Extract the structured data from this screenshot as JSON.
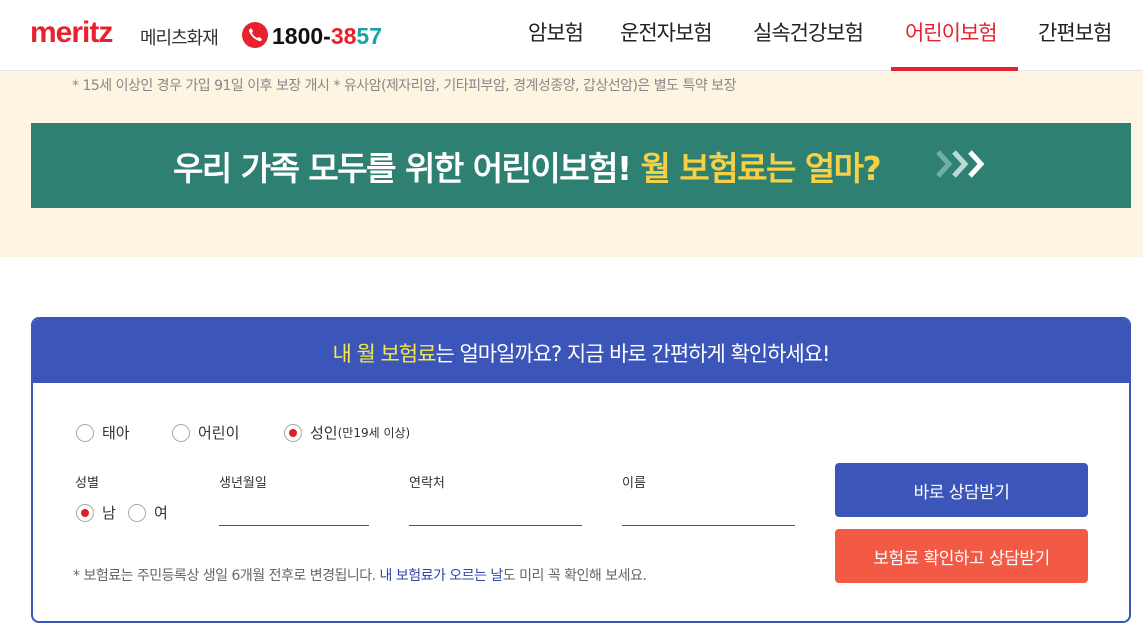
{
  "header": {
    "logo": "meritz",
    "logo_kr": "메리츠화재",
    "phone_part1": "1800-",
    "phone_part2": "38",
    "phone_part3": "57",
    "nav": [
      "암보험",
      "운전자보험",
      "실속건강보험",
      "어린이보험",
      "간편보험"
    ],
    "active_nav": "어린이보험"
  },
  "notice": "* 15세 이상인 경우 가입 91일 이후 보장 개시 * 유사암(제자리암, 기타피부암, 경계성종양, 갑상선암)은 별도 특약 보장",
  "banner": {
    "text_main": "우리 가족 모두를 위한 어린이보험! ",
    "text_highlight": "월 보험료는 얼마?"
  },
  "form": {
    "title_highlight": "내 월 보험료",
    "title_rest": "는 얼마일까요? 지금 바로 간편하게 확인하세요!",
    "age_options": [
      {
        "label": "태아",
        "sub": "",
        "selected": false
      },
      {
        "label": "어린이",
        "sub": "",
        "selected": false
      },
      {
        "label": "성인",
        "sub": "(만19세 이상)",
        "selected": true
      }
    ],
    "gender_label": "성별",
    "gender_options": [
      {
        "label": "남",
        "selected": true
      },
      {
        "label": "여",
        "selected": false
      }
    ],
    "birth_label": "생년월일",
    "contact_label": "연락처",
    "name_label": "이름",
    "birth_value": "",
    "contact_value": "",
    "name_value": "",
    "btn_consult": "바로 상담받기",
    "btn_check": "보험료 확인하고 상담받기",
    "note_pre": "* 보험료는 주민등록상 생일 6개월 전후로 변경됩니다. ",
    "note_highlight": "내 보험료가 오르는 날",
    "note_post": "도 미리 꼭 확인해 보세요."
  },
  "colors": {
    "brand_red": "#e8212f",
    "banner_green": "#2e8073",
    "form_blue": "#3c55b8",
    "button_red": "#f25a45",
    "cream": "#fdf5e1"
  }
}
